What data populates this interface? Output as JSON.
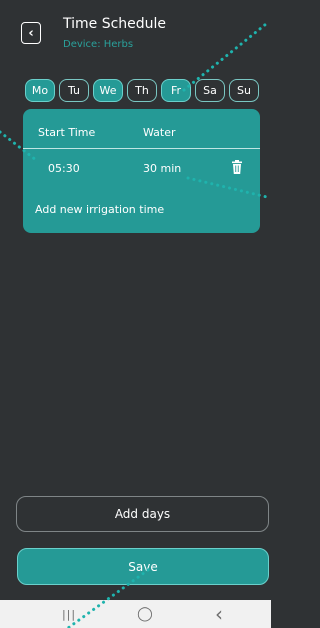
{
  "header": {
    "back_icon": "chevron-left-icon",
    "title": "Time Schedule",
    "subtitle": "Device: Herbs"
  },
  "days": [
    {
      "label": "Mo",
      "active": true
    },
    {
      "label": "Tu",
      "active": false
    },
    {
      "label": "We",
      "active": true
    },
    {
      "label": "Th",
      "active": false
    },
    {
      "label": "Fr",
      "active": true
    },
    {
      "label": "Sa",
      "active": false
    },
    {
      "label": "Su",
      "active": false
    }
  ],
  "schedule": {
    "columns": [
      "Start Time",
      "Water"
    ],
    "rows": [
      {
        "start_time": "05:30",
        "water": "30 min",
        "delete_icon": "trash-icon"
      }
    ],
    "add_label": "Add new irrigation time"
  },
  "buttons": {
    "add_days": "Add days",
    "save": "Save"
  },
  "navbar": {
    "recents": "|||",
    "home": "◯",
    "back": "‹"
  },
  "colors": {
    "background": "#2f3234",
    "accent": "#259a96",
    "subtitle": "#2aa19b",
    "navbar": "#f1f1f1"
  }
}
